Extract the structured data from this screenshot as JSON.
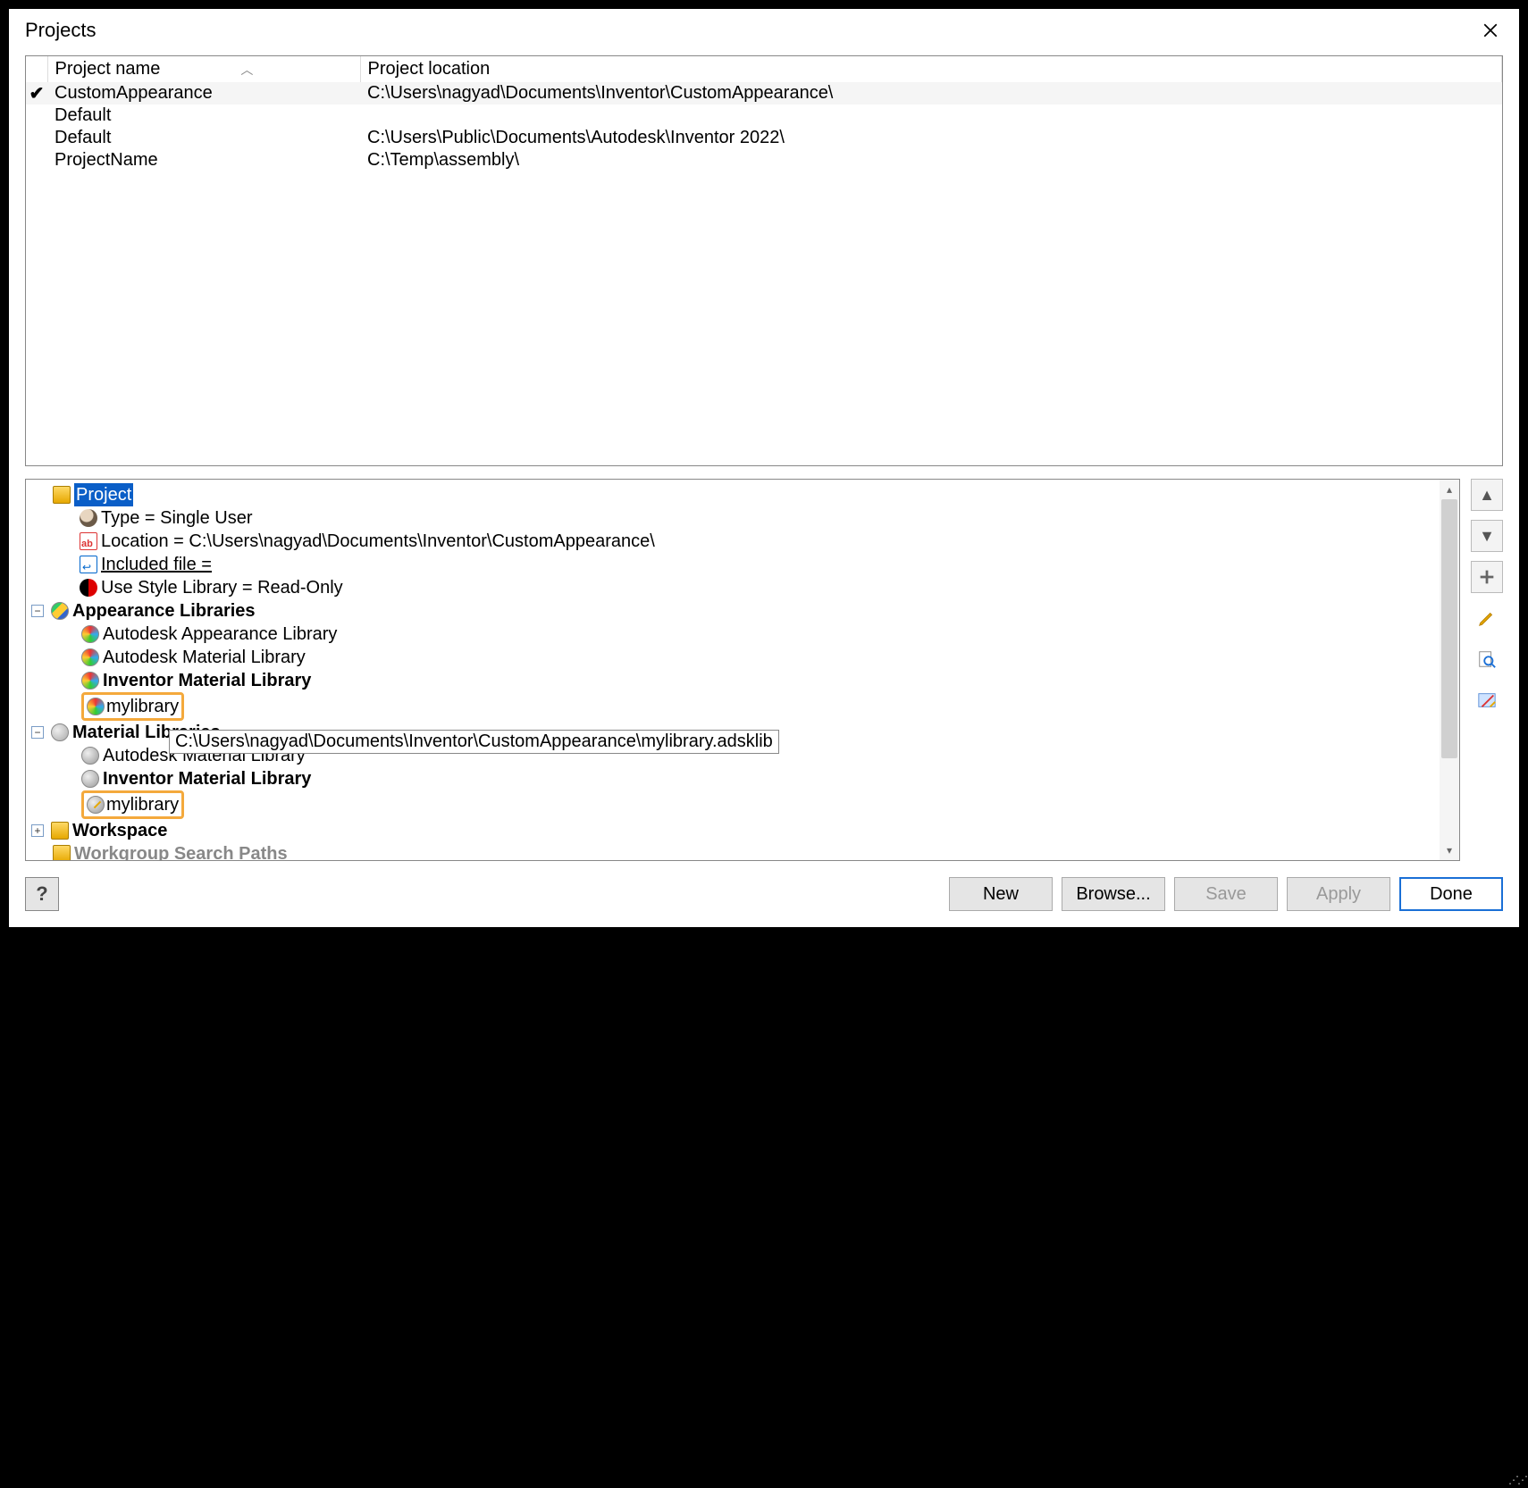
{
  "title": "Projects",
  "columns": {
    "name": "Project name",
    "location": "Project location"
  },
  "projects": [
    {
      "active": true,
      "name": "CustomAppearance",
      "location": "C:\\Users\\nagyad\\Documents\\Inventor\\CustomAppearance\\"
    },
    {
      "active": false,
      "name": "Default",
      "location": ""
    },
    {
      "active": false,
      "name": "Default",
      "location": "C:\\Users\\Public\\Documents\\Autodesk\\Inventor 2022\\"
    },
    {
      "active": false,
      "name": "ProjectName",
      "location": "C:\\Temp\\assembly\\"
    }
  ],
  "tree": {
    "root": "Project",
    "type": "Type = Single User",
    "location": "Location = C:\\Users\\nagyad\\Documents\\Inventor\\CustomAppearance\\",
    "included": "Included file = ",
    "style": "Use Style Library = Read-Only",
    "appearance_header": "Appearance Libraries",
    "appearance_items": [
      "Autodesk Appearance Library",
      "Autodesk Material Library",
      "Inventor Material Library",
      "mylibrary"
    ],
    "material_header": "Material Libraries",
    "material_items": [
      "Autodesk Material Library",
      "Inventor Material Library",
      "mylibrary"
    ],
    "workspace": "Workspace",
    "workgroup": "Workgroup Search Paths"
  },
  "tooltip": "C:\\Users\\nagyad\\Documents\\Inventor\\CustomAppearance\\mylibrary.adsklib",
  "buttons": {
    "new": "New",
    "browse": "Browse...",
    "save": "Save",
    "apply": "Apply",
    "done": "Done"
  }
}
